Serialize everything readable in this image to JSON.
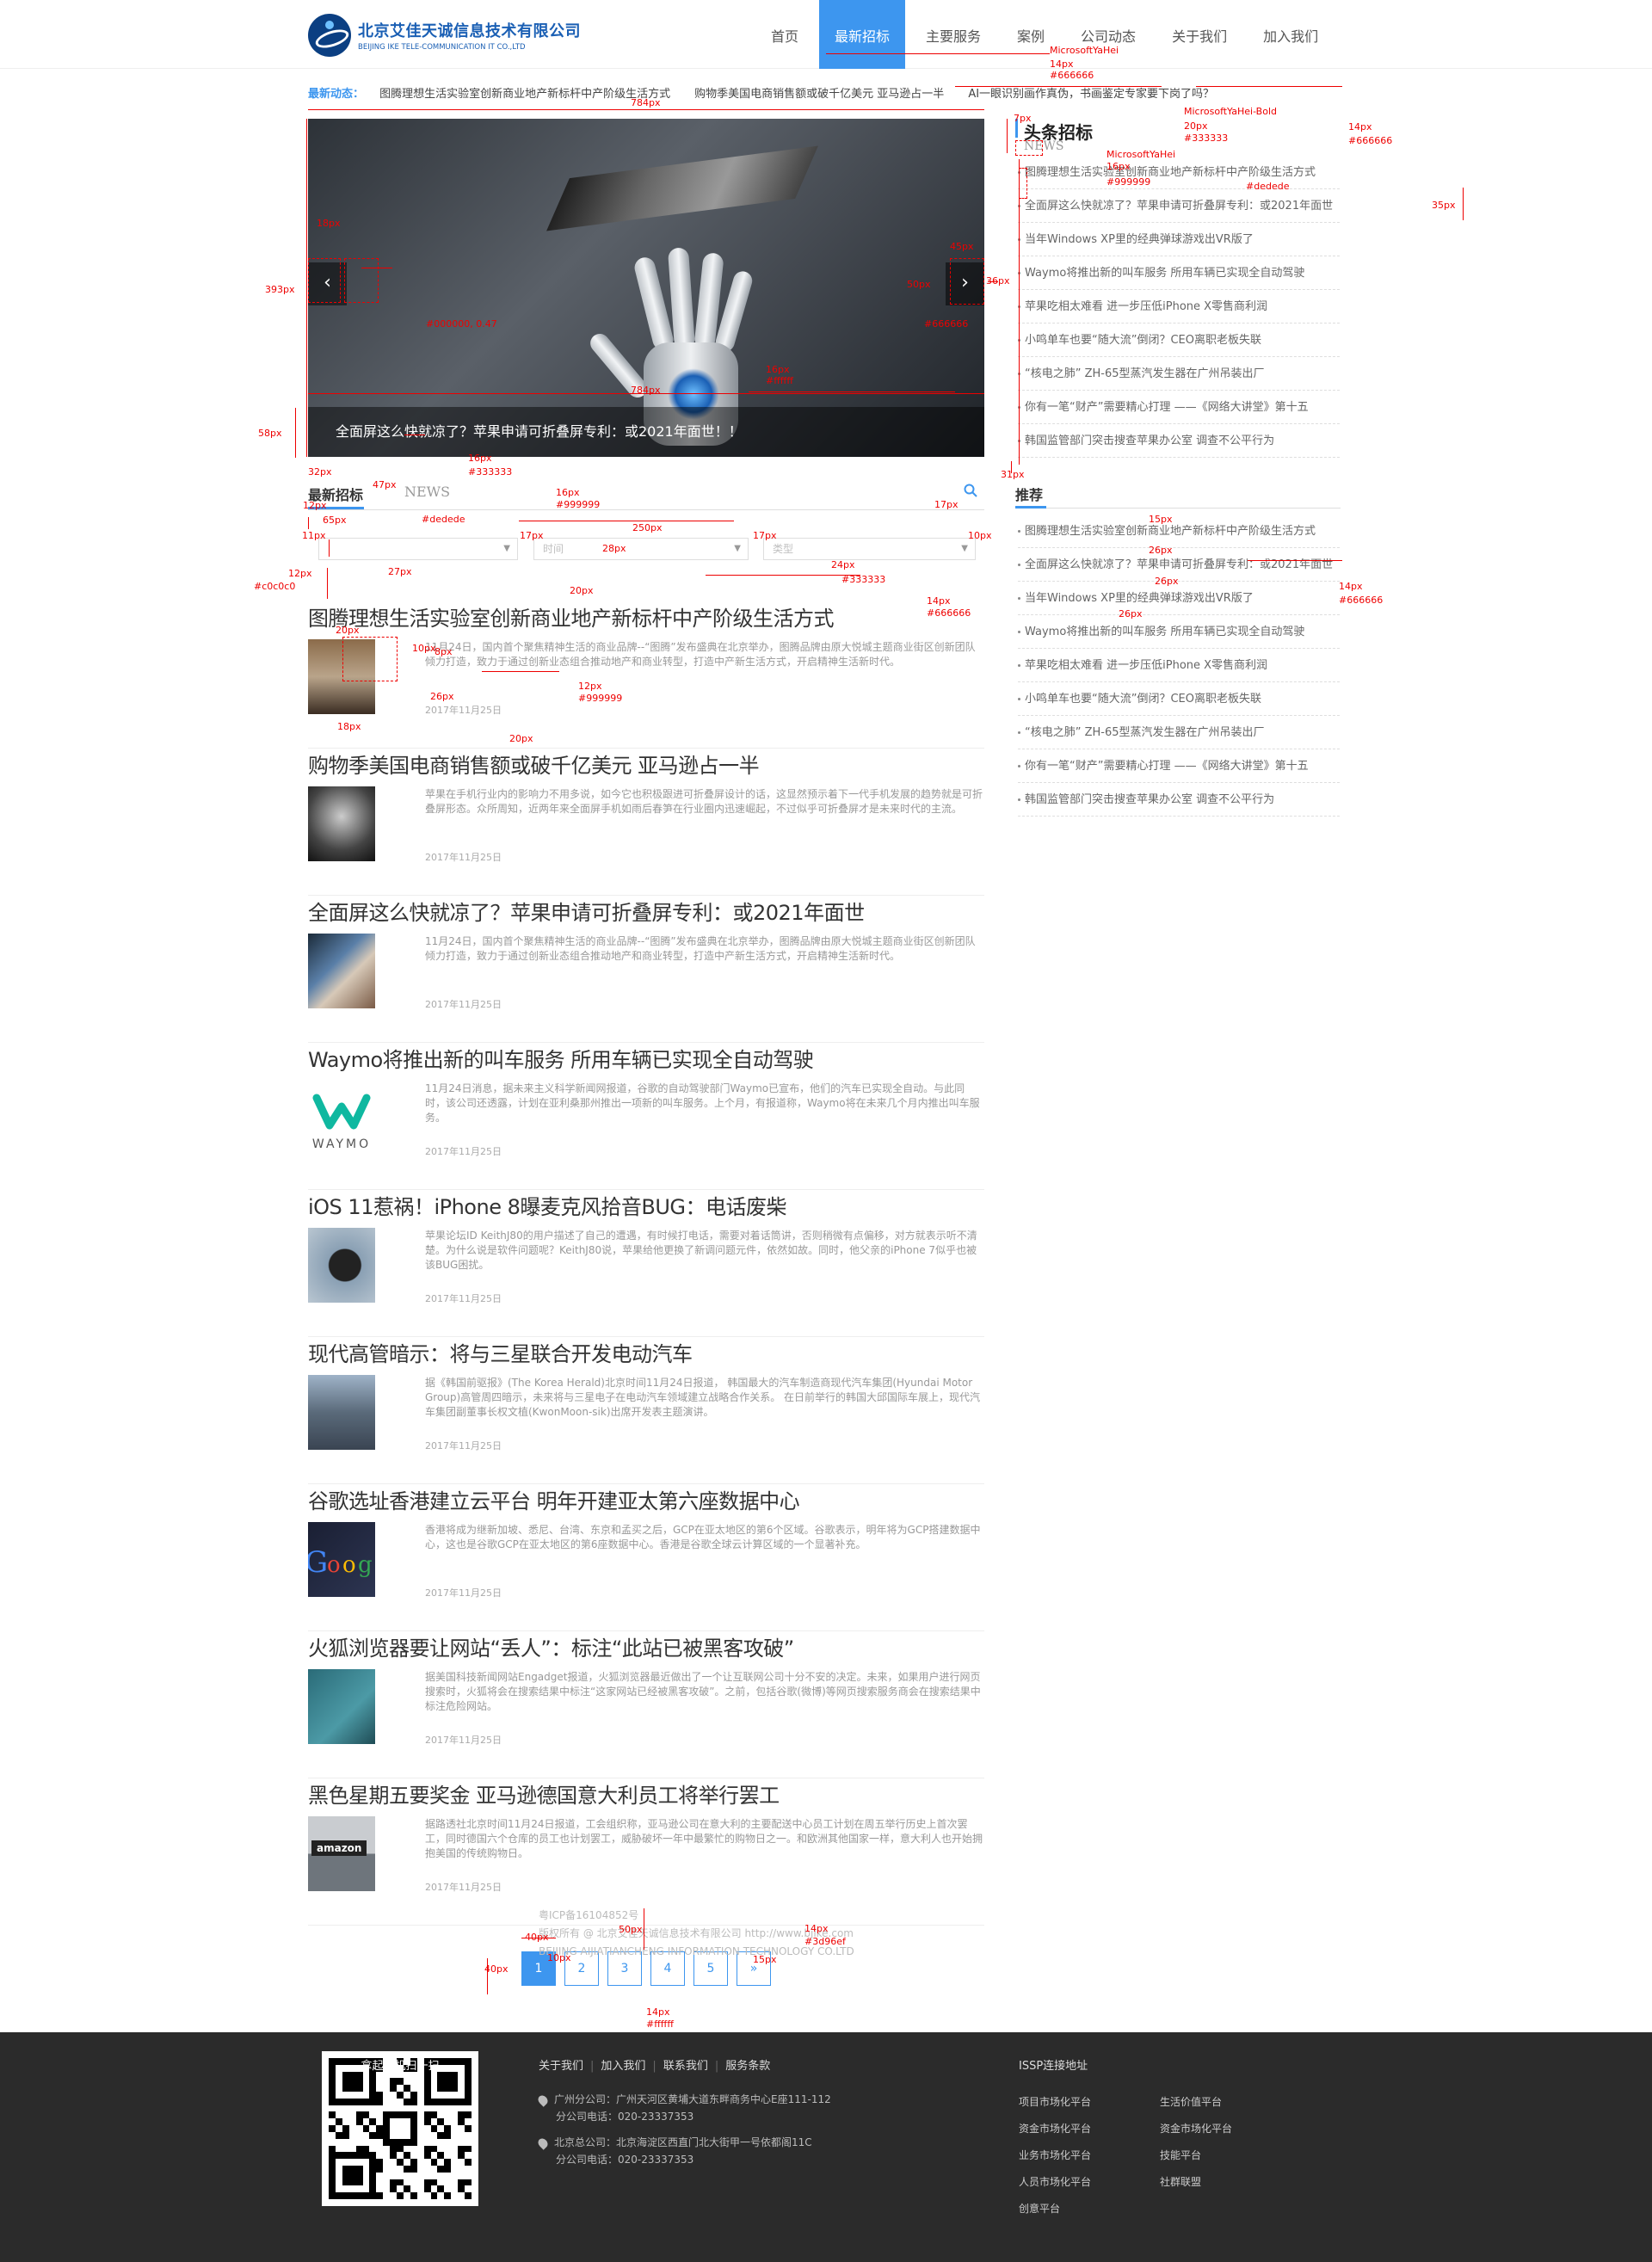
{
  "header": {
    "logo_cn": "北京艾佳天诚信息技术有限公司",
    "logo_en": "BEIJING IKE TELE-COMMUNICATION IT CO.,LTD",
    "nav": [
      "首页",
      "最新招标",
      "主要服务",
      "案例",
      "公司动态",
      "关于我们",
      "加入我们"
    ],
    "active_nav": 1,
    "accent": "#3d96ef"
  },
  "ticker": {
    "label": "最新动态：",
    "items": [
      "图腾理想生活实验室创新商业地产新标杆中产阶级生活方式",
      "购物季美国电商销售额或破千亿美元 亚马逊占一半",
      "AI一眼识别画作真伪，书画鉴定专家要下岗了吗？"
    ]
  },
  "slider": {
    "caption": "全面屏这么快就凉了？苹果申请可折叠屏专利：或2021年面世！！",
    "prev_icon": "chevron-left-icon",
    "next_icon": "chevron-right-icon"
  },
  "headlines": {
    "title": "头条招标",
    "subtitle": "NEWS",
    "items": [
      "图腾理想生活实验室创新商业地产新标杆中产阶级生活方式",
      "全面屏这么快就凉了？苹果申请可折叠屏专利：或2021年面世",
      "当年Windows XP里的经典弹球游戏出VR版了",
      "Waymo将推出新的叫车服务 所用车辆已实现全自动驾驶",
      "苹果吃相太难看 进一步压低iPhone X零售商利润",
      "小鸣单车也要“随大流”倒闭？CEO离职老板失联",
      "“核电之肺” ZH-65型蒸汽发生器在广州吊装出厂",
      "你有一笔“财产”需要精心打理 ——《网络大讲堂》第十五",
      "韩国监管部门突击搜查苹果办公室 调查不公平行为"
    ]
  },
  "recommend": {
    "title": "推荐",
    "items": [
      "图腾理想生活实验室创新商业地产新标杆中产阶级生活方式",
      "全面屏这么快就凉了？苹果申请可折叠屏专利：或2021年面世",
      "当年Windows XP里的经典弹球游戏出VR版了",
      "Waymo将推出新的叫车服务 所用车辆已实现全自动驾驶",
      "苹果吃相太难看 进一步压低iPhone X零售商利润",
      "小鸣单车也要“随大流”倒闭？CEO离职老板失联",
      "“核电之肺” ZH-65型蒸汽发生器在广州吊装出厂",
      "你有一笔“财产”需要精心打理 ——《网络大讲堂》第十五",
      "韩国监管部门突击搜查苹果办公室 调查不公平行为"
    ]
  },
  "news": {
    "title": "最新招标",
    "subtitle": "NEWS",
    "search_icon": "search-icon",
    "filters": {
      "region": "",
      "time": "时间",
      "type": "类型"
    },
    "articles": [
      {
        "title": "图腾理想生活实验室创新商业地产新标杆中产阶级生活方式",
        "text": "11月24日，国内首个聚焦精神生活的商业品牌--“图腾”发布盛典在北京举办，图腾品牌由原大悦城主题商业街区创新团队倾力打造，致力于通过创新业态组合推动地产和商业转型，打造中产新生活方式，开启精神生活新时代。",
        "date": "2017年11月25日"
      },
      {
        "title": "购物季美国电商销售额或破千亿美元 亚马逊占一半",
        "text": "苹果在手机行业内的影响力不用多说，如今它也积极跟进可折叠屏设计的话，这显然预示着下一代手机发展的趋势就是可折叠屏形态。众所周知，近两年来全面屏手机如雨后春笋在行业圈内迅速崛起，不过似乎可折叠屏才是未来时代的主流。",
        "date": "2017年11月25日"
      },
      {
        "title": "全面屏这么快就凉了？苹果申请可折叠屏专利：或2021年面世",
        "text": "11月24日，国内首个聚焦精神生活的商业品牌--“图腾”发布盛典在北京举办，图腾品牌由原大悦城主题商业街区创新团队倾力打造，致力于通过创新业态组合推动地产和商业转型，打造中产新生活方式，开启精神生活新时代。",
        "date": "2017年11月25日"
      },
      {
        "title": "Waymo将推出新的叫车服务 所用车辆已实现全自动驾驶",
        "text": "11月24日消息，据未来主义科学新闻网报道，谷歌的自动驾驶部门Waymo已宣布，他们的汽车已实现全自动。与此同时，该公司还透露，计划在亚利桑那州推出一项新的叫车服务。上个月，有报道称，Waymo将在未来几个月内推出叫车服务。",
        "date": "2017年11月25日"
      },
      {
        "title": "iOS 11惹祸！iPhone 8曝麦克风拾音BUG：电话废柴",
        "text": "苹果论坛ID KeithJ80的用户描述了自己的遭遇，有时候打电话，需要对着话筒讲，否则稍微有点偏移，对方就表示听不清楚。为什么说是软件问题呢？KeithJ80说，苹果给他更换了新调问题元件，依然如故。同时，他父亲的iPhone 7似乎也被该BUG困扰。",
        "date": "2017年11月25日"
      },
      {
        "title": "现代高管暗示：将与三星联合开发电动汽车",
        "text": "据《韩国前驱报》(The Korea Herald)北京时间11月24日报道， 韩国最大的汽车制造商现代汽车集团(Hyundai Motor Group)高管周四暗示，未来将与三星电子在电动汽车领域建立战略合作关系。 在日前举行的韩国大邱国际车展上，现代汽车集团副董事长权文植(KwonMoon-sik)出席开发表主题演讲。",
        "date": "2017年11月25日"
      },
      {
        "title": "谷歌选址香港建立云平台 明年开建亚太第六座数据中心",
        "text": "香港将成为继新加坡、悉尼、台湾、东京和孟买之后，GCP在亚太地区的第6个区域。谷歌表示，明年将为GCP搭建数据中心，这也是谷歌GCP在亚太地区的第6座数据中心。香港是谷歌全球云计算区域的一个显著补充。",
        "date": "2017年11月25日"
      },
      {
        "title": "火狐浏览器要让网站“丢人”：标注“此站已被黑客攻破”",
        "text": "据美国科技新闻网站Engadget报道，火狐浏览器最近做出了一个让互联网公司十分不安的决定。未来，如果用户进行网页搜索时，火狐将会在搜索结果中标注“这家网站已经被黑客攻破”。之前，包括谷歌(微博)等网页搜索服务商会在搜索结果中标注危险网站。",
        "date": "2017年11月25日"
      },
      {
        "title": "黑色星期五要奖金 亚马逊德国意大利员工将举行罢工",
        "text": "据路透社北京时间11月24日报道，工会组织称，亚马逊公司在意大利的主要配送中心员工计划在周五举行历史上首次罢工，同时德国六个仓库的员工也计划罢工，威胁破坏一年中最繁忙的购物日之一。和欧洲其他国家一样，意大利人也开始拥抱美国的传统购物日。",
        "date": "2017年11月25日"
      }
    ]
  },
  "pagination": {
    "pages": [
      "1",
      "2",
      "3",
      "4",
      "5"
    ],
    "next": "»",
    "current": 0
  },
  "footer": {
    "links": [
      "关于我们",
      "加入我们",
      "联系我们",
      "服务条款"
    ],
    "gz_office": "广州分公司：广州天河区黄埔大道东畔商务中心E座111-112",
    "gz_phone": "分公司电话：020-23337353",
    "bj_office": "北京总公司：北京海淀区西直门北大街甲一号依都阁11C",
    "bj_phone": "分公司电话：020-23337353",
    "icp": "粤ICP备16104852号",
    "copyright": "版权所有 @ 北京艾佳天诚信息技术有限公司 http://www.bjike.com",
    "company_en": "BEIJING AIJIATIANCHENG INFORMATION TECHNOLOGY CO.LTD",
    "qr_label": "拿起手机扫一扫",
    "issp_title": "ISSP连接地址",
    "issp_col1": [
      "项目市场化平台",
      "资金市场化平台",
      "业务市场化平台",
      "人员市场化平台",
      "创意平台"
    ],
    "issp_col2": [
      "生活价值平台",
      "资金市场化平台",
      "技能平台",
      "社群联盟"
    ]
  },
  "annotations": {
    "color": "#ff0000",
    "labels": [
      "MicrosoftYaHei",
      "14px",
      "#666666",
      "784px",
      "7px",
      "MicrosoftYaHei-Bold",
      "20px",
      "#333333",
      "14px",
      "#666666",
      "MicrosoftYaHei",
      "16px",
      "#999999",
      "#dedede",
      "35px",
      "393px",
      "18px",
      "45px",
      "50px",
      "36px",
      "#666666",
      "#000000, 0.47",
      "16px",
      "#ffffff",
      "784px",
      "58px",
      "32px",
      "16px",
      "#333333",
      "47px",
      "16px",
      "#999999",
      "17px",
      "31px",
      "12px",
      "65px",
      "#dedede",
      "250px",
      "11px",
      "17px",
      "28px",
      "17px",
      "10px",
      "12px",
      "#c0c0c0",
      "27px",
      "24px",
      "#333333",
      "20px",
      "20px",
      "14px",
      "#666666",
      "26px",
      "12px",
      "#999999",
      "18px",
      "20px",
      "15px",
      "26px",
      "26px",
      "26px",
      "14px",
      "#666666",
      "40px",
      "50px",
      "14px",
      "#3d96ef",
      "40px",
      "10px",
      "15px",
      "14px",
      "#ffffff",
      "8px",
      "10px"
    ]
  }
}
